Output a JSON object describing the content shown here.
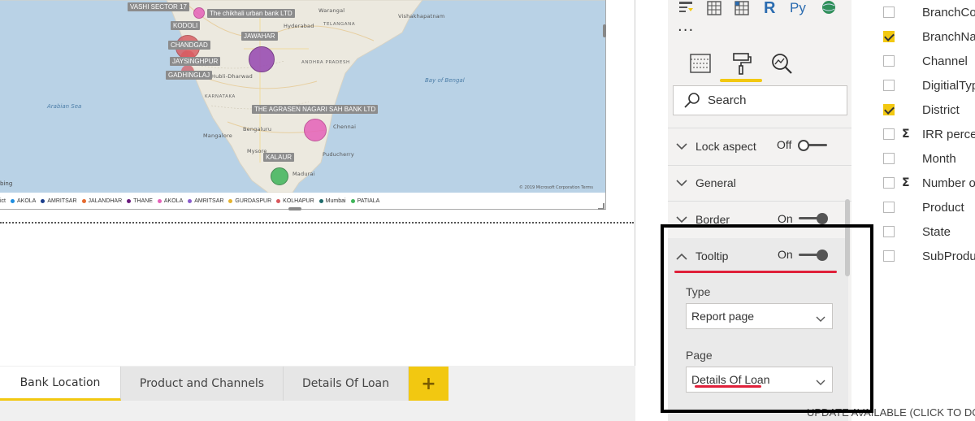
{
  "map": {
    "bubble_labels": [
      "VASHI SECTOR 17",
      "The chikhali urban bank LTD",
      "KODOLI",
      "CHANDGAD",
      "JAYSINGHPUR",
      "GADHINGLAJ",
      "JAWAHAR",
      "THE AGRASEN NAGARI SAH BANK LTD",
      "KALAUR"
    ],
    "city_labels": [
      "Warangal",
      "Vishakhapatnam",
      "Hyderabad",
      "Telangana",
      "ANDHRA PRADESH",
      "Hubli-Dharwad",
      "KARNATAKA",
      "Mangalore",
      "Bengaluru",
      "Mysore",
      "Chennai",
      "Puducherry",
      "Madurai"
    ],
    "sea_labels": [
      "Arabian Sea",
      "Bay of Bengal"
    ],
    "attribution": "bing",
    "copyright": "© 2019 Microsoft Corporation  Terms",
    "colors": {
      "pink": "#e561b9",
      "purple": "#9b4fb3",
      "red": "#d9575c",
      "green": "#3fb55a"
    }
  },
  "legend": {
    "title": "ict",
    "items": [
      {
        "label": "AKOLA",
        "color": "#1f8ee0"
      },
      {
        "label": "AMRITSAR",
        "color": "#1a3e8c"
      },
      {
        "label": "JALANDHAR",
        "color": "#e56a2e"
      },
      {
        "label": "THANE",
        "color": "#6a1b7c"
      },
      {
        "label": "AKOLA",
        "color": "#e561b9"
      },
      {
        "label": "AMRITSAR",
        "color": "#8a5ccc"
      },
      {
        "label": "GURDASPUR",
        "color": "#e5b32e"
      },
      {
        "label": "KOLHAPUR",
        "color": "#d9575c"
      },
      {
        "label": "Mumbai",
        "color": "#1e6b6b"
      },
      {
        "label": "PATIALA",
        "color": "#3fb55a"
      }
    ]
  },
  "tabs": {
    "bank_location": "Bank Location",
    "product_channels": "Product and Channels",
    "details_of_loan": "Details Of Loan",
    "add": "+"
  },
  "format_pane": {
    "more": "...",
    "search_placeholder": "Search",
    "cards": {
      "lock_aspect": "Lock aspect",
      "lock_aspect_state": "Off",
      "general": "General",
      "border": "Border",
      "border_state": "On",
      "tooltip": "Tooltip",
      "tooltip_state": "On"
    },
    "tooltip": {
      "type_label": "Type",
      "type_value": "Report page",
      "page_label": "Page",
      "page_value": "Details Of Loan"
    }
  },
  "fields": [
    {
      "name": "BranchCode",
      "checked": false,
      "sigma": false
    },
    {
      "name": "BranchName",
      "checked": true,
      "sigma": false
    },
    {
      "name": "Channel",
      "checked": false,
      "sigma": false
    },
    {
      "name": "DigitialType",
      "checked": false,
      "sigma": false
    },
    {
      "name": "District",
      "checked": true,
      "sigma": false
    },
    {
      "name": "IRR percent",
      "checked": false,
      "sigma": true
    },
    {
      "name": "Month",
      "checked": false,
      "sigma": false
    },
    {
      "name": "Number of",
      "checked": false,
      "sigma": true
    },
    {
      "name": "Product",
      "checked": false,
      "sigma": false
    },
    {
      "name": "State",
      "checked": false,
      "sigma": false
    },
    {
      "name": "SubProduct",
      "checked": false,
      "sigma": false
    }
  ],
  "update_banner": "UPDATE AVAILABLE (CLICK TO DOWNLOAD)",
  "colors": {
    "accent": "#f2c811",
    "annotation_red": "#e0203a"
  }
}
